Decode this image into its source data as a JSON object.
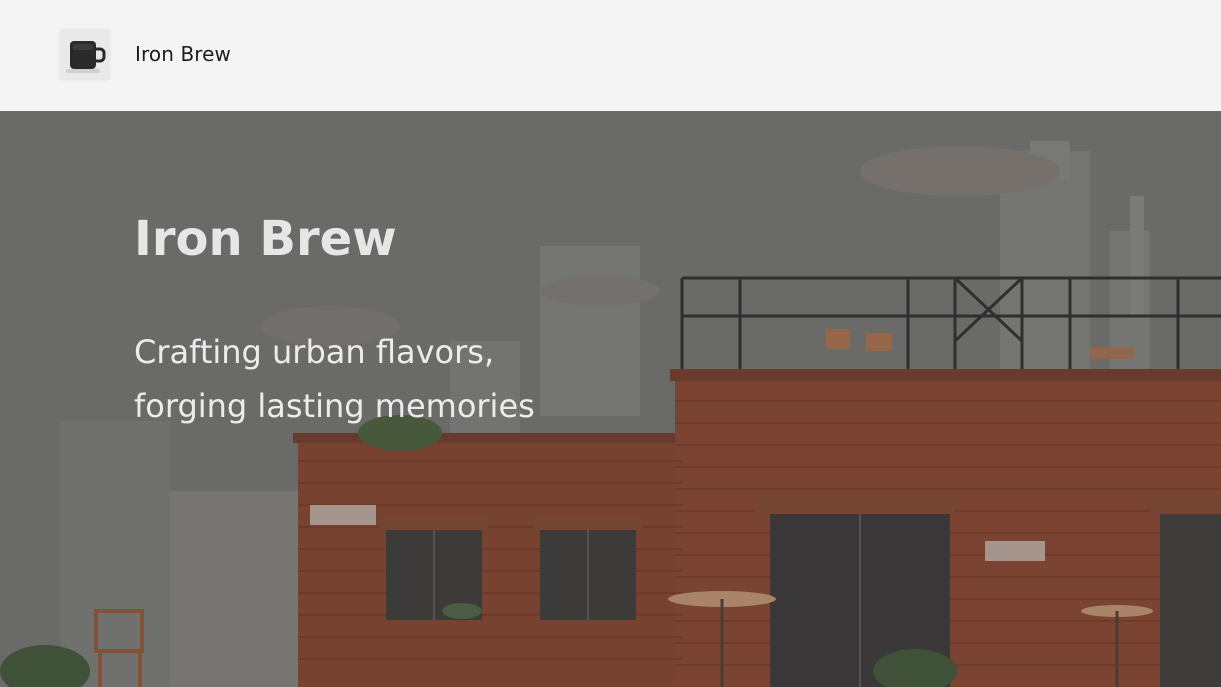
{
  "nav": {
    "brand_name": "Iron Brew",
    "logo_icon": "coffee-mug-icon"
  },
  "hero": {
    "title": "Iron Brew",
    "subtitle_lines": [
      "Crafting urban flavors,",
      "forging lasting memories"
    ],
    "background_image": "urban brick cafe illustration with rooftop terrace"
  },
  "colors": {
    "nav_bg": "#f4f4f4",
    "hero_bg": "#6f6f6e",
    "brick": "#8c4a34",
    "hero_text": "#e6e6e6"
  }
}
